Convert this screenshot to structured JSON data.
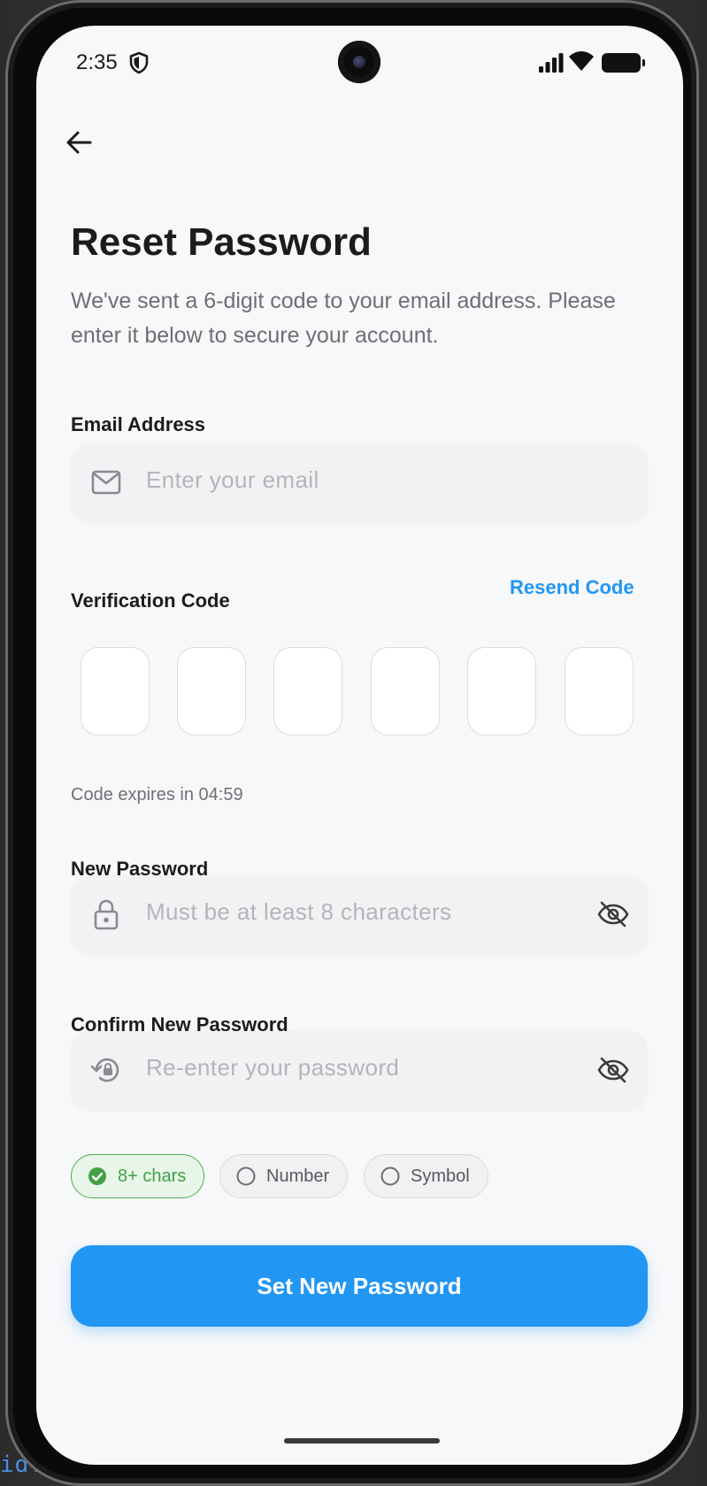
{
  "status_bar": {
    "time": "2:35"
  },
  "header": {
    "title": "Reset Password",
    "subtitle": "We've sent a 6-digit code to your email address. Please enter it below to secure your account."
  },
  "email": {
    "label": "Email Address",
    "placeholder": "Enter your email",
    "value": ""
  },
  "verification": {
    "label": "Verification Code",
    "resend_label": "Resend Code",
    "digits": [
      "",
      "",
      "",
      "",
      "",
      ""
    ],
    "expiry_text": "Code expires in 04:59"
  },
  "new_password": {
    "label": "New Password",
    "placeholder": "Must be at least 8 characters",
    "value": ""
  },
  "confirm_password": {
    "label": "Confirm New Password",
    "placeholder": "Re-enter your password",
    "value": ""
  },
  "requirements": [
    {
      "label": "8+ chars",
      "met": true
    },
    {
      "label": "Number",
      "met": false
    },
    {
      "label": "Symbol",
      "met": false
    }
  ],
  "submit": {
    "label": "Set New Password"
  },
  "code_peek": "id:.",
  "colors": {
    "accent": "#2196f3",
    "success": "#43a047",
    "background": "#f7f8fa",
    "text": "#1c1c1e",
    "muted": "#6e6e73"
  },
  "icons": [
    "back-arrow-icon",
    "mail-icon",
    "lock-icon",
    "lock-reset-icon",
    "eye-off-icon",
    "check-circle-icon",
    "circle-icon",
    "shield-icon",
    "signal-icon",
    "wifi-icon",
    "battery-icon"
  ]
}
